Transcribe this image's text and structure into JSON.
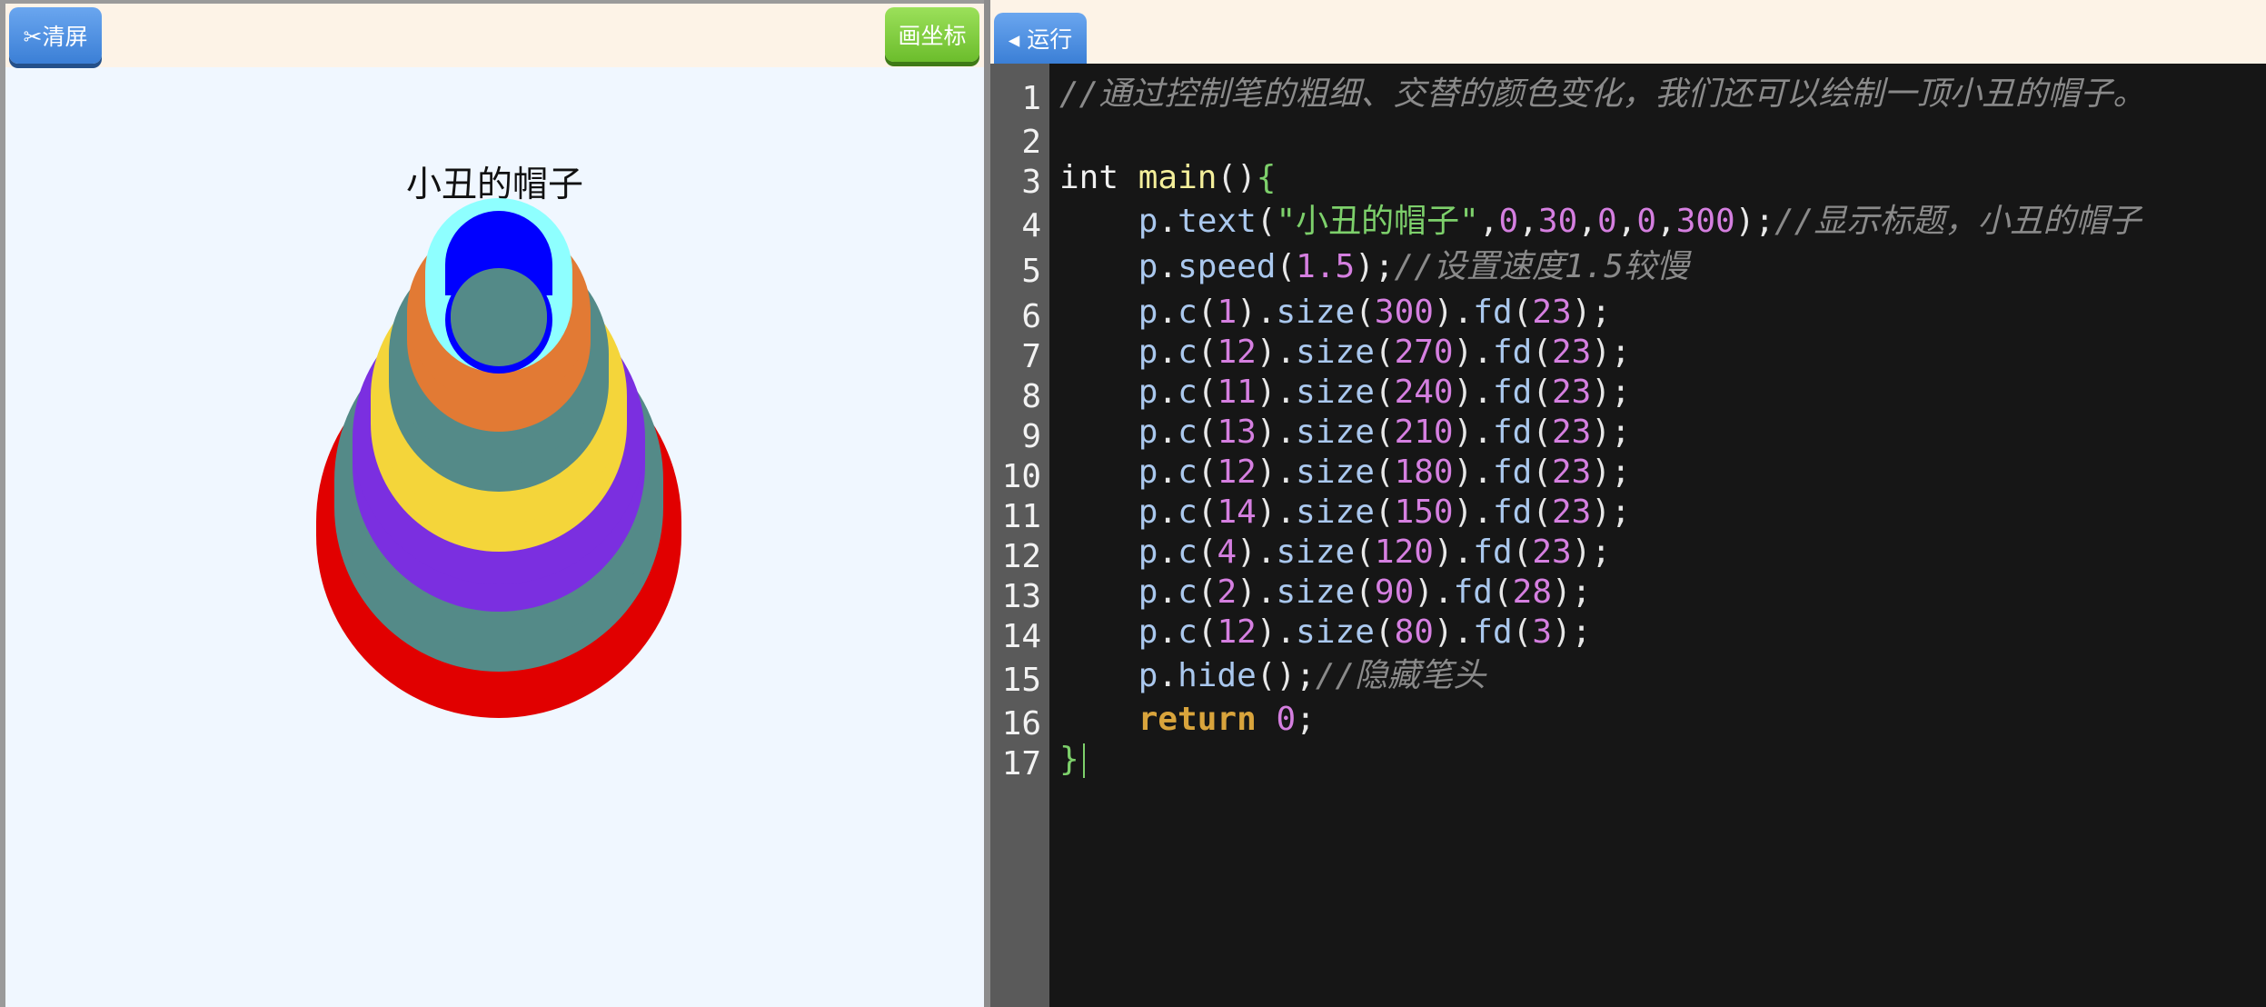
{
  "toolbar": {
    "clear_label": "✂清屏",
    "axis_label": "画坐标",
    "run_label": "◂ 运行"
  },
  "canvas": {
    "title": "小丑的帽子",
    "colors": {
      "red": "#e10000",
      "teal": "#548a88",
      "purple": "#7b2fe0",
      "yellow": "#f4d53a",
      "orange": "#e27a34",
      "cyan": "#8effff",
      "blue": "#0000ff"
    }
  },
  "editor": {
    "line_numbers": [
      "1",
      "2",
      "3",
      "4",
      "5",
      "6",
      "7",
      "8",
      "9",
      "10",
      "11",
      "12",
      "13",
      "14",
      "15",
      "16",
      "17"
    ],
    "lines": [
      "//通过控制笔的粗细、交替的颜色变化，我们还可以绘制一顶小丑的帽子。",
      "",
      "int main(){",
      "    p.text(\"小丑的帽子\",0,30,0,0,300);//显示标题，小丑的帽子",
      "    p.speed(1.5);//设置速度1.5较慢",
      "    p.c(1).size(300).fd(23);",
      "    p.c(12).size(270).fd(23);",
      "    p.c(11).size(240).fd(23);",
      "    p.c(13).size(210).fd(23);",
      "    p.c(12).size(180).fd(23);",
      "    p.c(14).size(150).fd(23);",
      "    p.c(4).size(120).fd(23);",
      "    p.c(2).size(90).fd(28);",
      "    p.c(12).size(80).fd(3);",
      "    p.hide();//隐藏笔头",
      "    return 0;",
      "}"
    ]
  }
}
